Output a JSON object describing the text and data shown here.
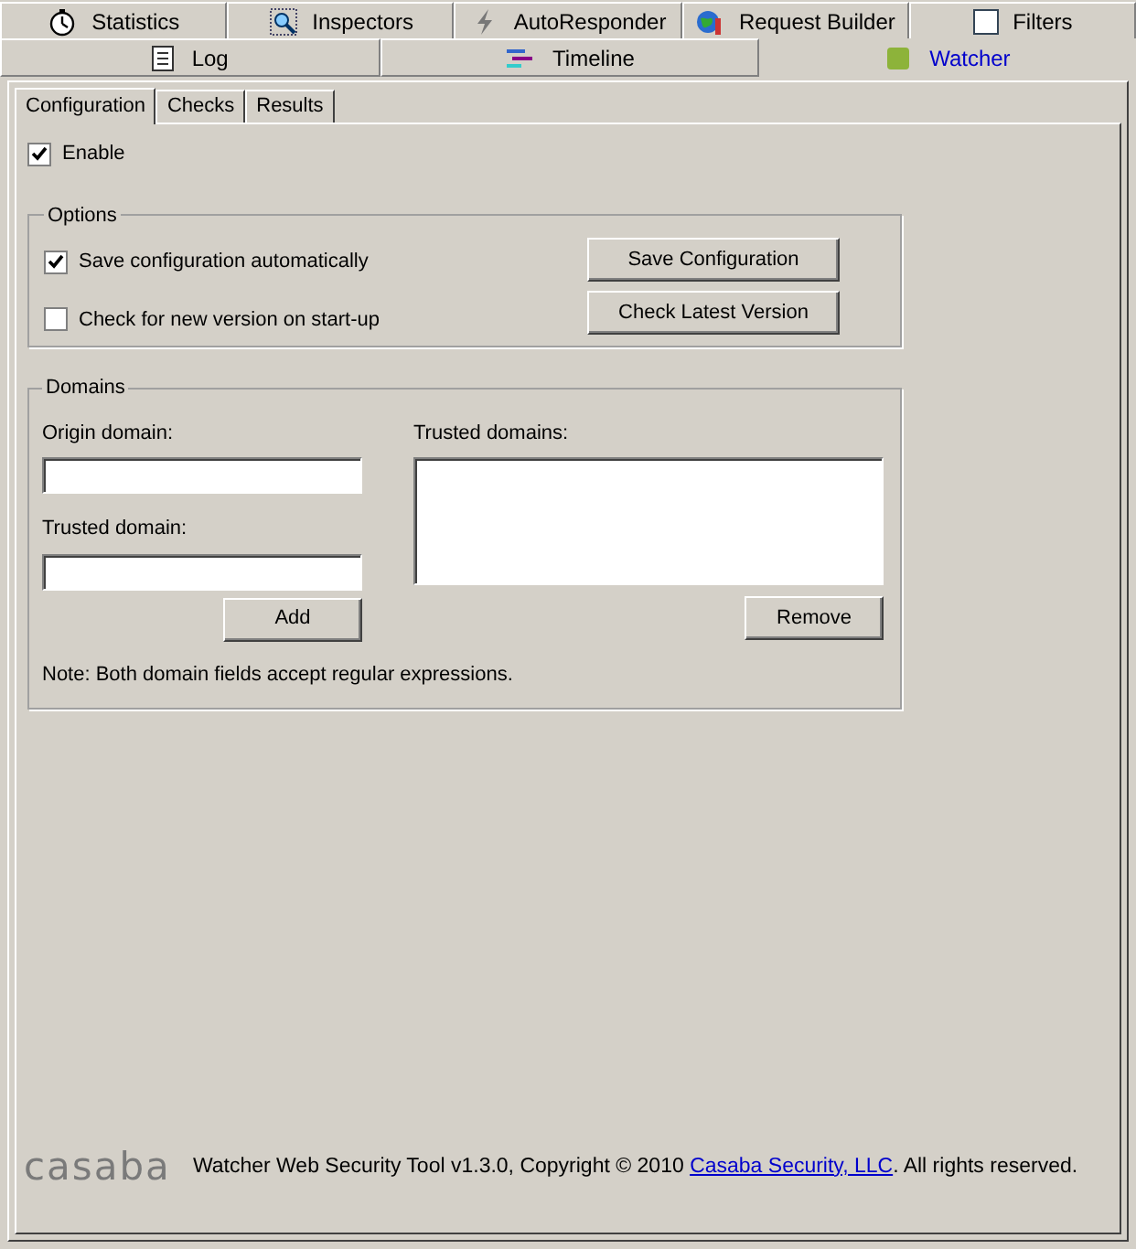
{
  "top_tabs": [
    {
      "label": "Statistics",
      "selected": false
    },
    {
      "label": "Inspectors",
      "selected": false
    },
    {
      "label": "AutoResponder",
      "selected": false
    },
    {
      "label": "Request Builder",
      "selected": false
    },
    {
      "label": "Filters",
      "selected": false
    }
  ],
  "second_tabs": [
    {
      "label": "Log",
      "selected": false
    },
    {
      "label": "Timeline",
      "selected": false
    },
    {
      "label": "Watcher",
      "selected": true
    }
  ],
  "sub_tabs": [
    {
      "label": "Configuration",
      "selected": true
    },
    {
      "label": "Checks",
      "selected": false
    },
    {
      "label": "Results",
      "selected": false
    }
  ],
  "enable": {
    "label": "Enable",
    "checked": true
  },
  "options": {
    "title": "Options",
    "checkboxes": [
      {
        "label": "Save configuration automatically",
        "checked": true
      },
      {
        "label": "Check for new version on start-up",
        "checked": false
      }
    ],
    "buttons": [
      "Save Configuration",
      "Check Latest Version"
    ]
  },
  "domains": {
    "title": "Domains",
    "origin_label": "Origin domain:",
    "trusted_label": "Trusted domain:",
    "add_button": "Add",
    "list_label": "Trusted domains:",
    "remove_button": "Remove",
    "note": "Note: Both domain fields accept regular expressions."
  },
  "footer": {
    "logo": "casaba",
    "text": "Watcher Web Security Tool v1.3.0, Copyright © 2010",
    "link": "Casaba Security, LLC",
    "rest": ". All rights reserved."
  }
}
